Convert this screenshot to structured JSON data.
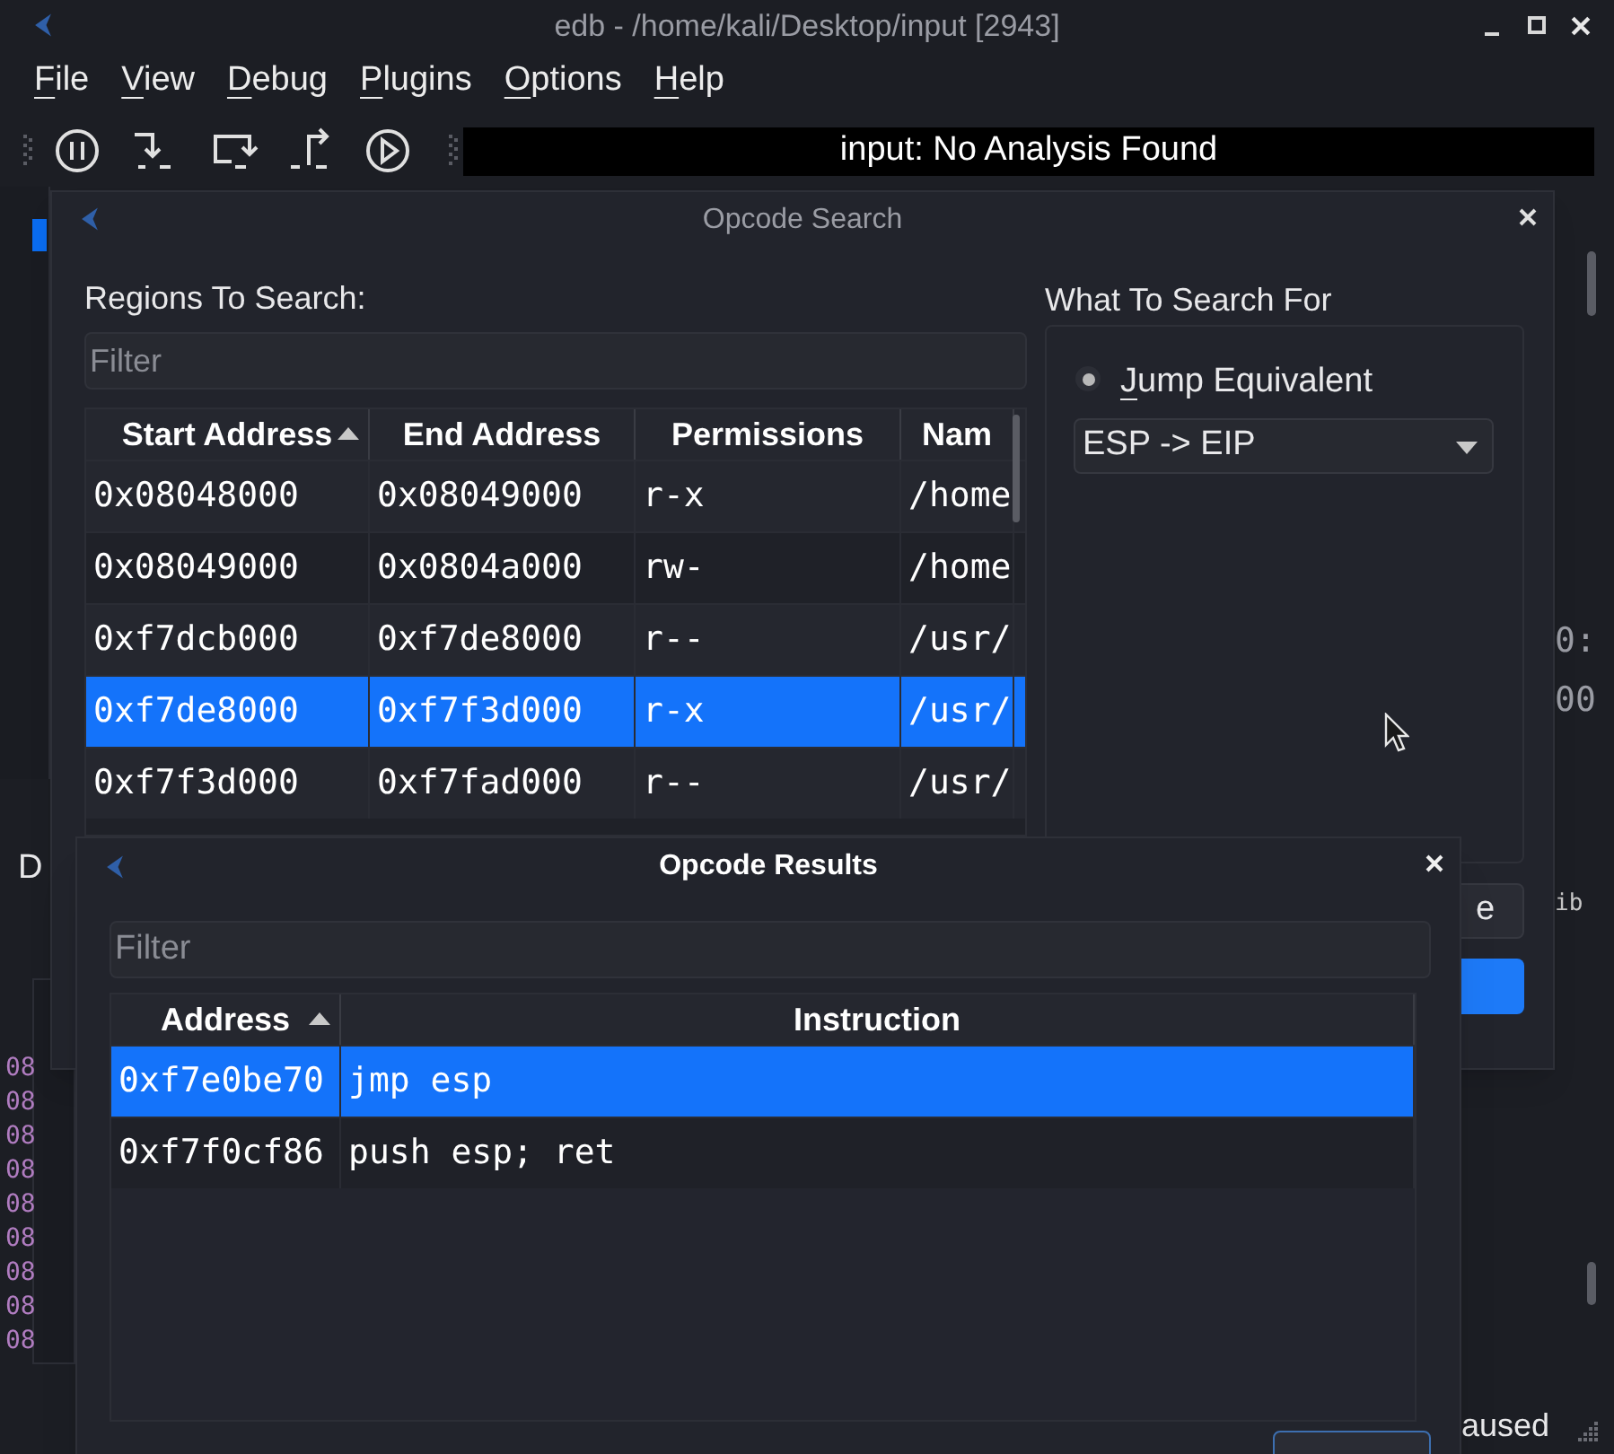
{
  "window": {
    "title": "edb - /home/kali/Desktop/input [2943]"
  },
  "menu": [
    "File",
    "View",
    "Debug",
    "Plugins",
    "Options",
    "Help"
  ],
  "toolbar": {
    "analysis": "input: No Analysis Found"
  },
  "background": {
    "left_label": "D",
    "hex_column": [
      "08",
      "08",
      "08",
      "08",
      "08",
      "08",
      "08",
      "08",
      "08"
    ],
    "right_texts": [
      "0:",
      "00"
    ],
    "right_code": "ib",
    "status": "aused"
  },
  "opcode_search": {
    "title": "Opcode Search",
    "regions_label": "Regions To Search:",
    "filter": {
      "placeholder": "Filter"
    },
    "columns": [
      {
        "label": "Start Address",
        "sorted": true
      },
      {
        "label": "End Address",
        "sorted": false
      },
      {
        "label": "Permissions",
        "sorted": false
      },
      {
        "label": "Nam",
        "sorted": false
      }
    ],
    "rows": [
      {
        "cells": [
          "0x08048000",
          "0x08049000",
          "r-x",
          "/home"
        ],
        "selected": false
      },
      {
        "cells": [
          "0x08049000",
          "0x0804a000",
          "rw-",
          "/home"
        ],
        "selected": false
      },
      {
        "cells": [
          "0xf7dcb000",
          "0xf7de8000",
          "r--",
          "/usr/"
        ],
        "selected": false
      },
      {
        "cells": [
          "0xf7de8000",
          "0xf7f3d000",
          "r-x",
          "/usr/"
        ],
        "selected": true
      },
      {
        "cells": [
          "0xf7f3d000",
          "0xf7fad000",
          "r--",
          "/usr/"
        ],
        "selected": false
      }
    ],
    "what_label": "What To Search For",
    "radio": {
      "label": "Jump Equivalent",
      "checked": true
    },
    "combo": {
      "value": "ESP -> EIP"
    },
    "partial_button": "e"
  },
  "opcode_results": {
    "title": "Opcode Results",
    "filter": {
      "placeholder": "Filter"
    },
    "columns": [
      {
        "label": "Address",
        "sorted": true
      },
      {
        "label": "Instruction",
        "sorted": false
      }
    ],
    "rows": [
      {
        "cells": [
          "0xf7e0be70",
          "jmp esp"
        ],
        "selected": true
      },
      {
        "cells": [
          "0xf7f0cf86",
          "push esp; ret"
        ],
        "selected": false
      }
    ]
  }
}
